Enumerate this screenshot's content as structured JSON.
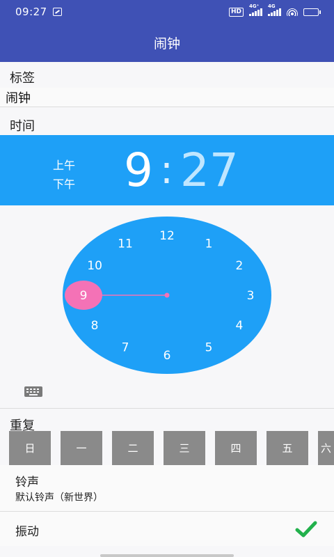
{
  "status_bar": {
    "time": "09:27",
    "hd": "HD",
    "sim1": "4G⁺",
    "sim2": "4G"
  },
  "app_bar": {
    "title": "闹钟"
  },
  "label_section": {
    "heading": "标签",
    "value": "闹钟"
  },
  "time_section": {
    "heading": "时间",
    "am": "上午",
    "pm": "下午",
    "hour": "9",
    "separator": ":",
    "minute": "27"
  },
  "clock": {
    "numbers": [
      "12",
      "1",
      "2",
      "3",
      "4",
      "5",
      "6",
      "7",
      "8",
      "9",
      "10",
      "11"
    ],
    "selected_hour": 9,
    "face_color": "#1ea0f7",
    "hand_color": "#f472b6"
  },
  "repeat_section": {
    "heading": "重复",
    "days": [
      "日",
      "一",
      "二",
      "三",
      "四",
      "五",
      "六"
    ]
  },
  "ringtone_section": {
    "title": "铃声",
    "value": "默认铃声（新世界）"
  },
  "vibrate_section": {
    "title": "振动",
    "checked": true
  },
  "colors": {
    "primary": "#3f51b5",
    "accent": "#1ea0f7",
    "day_button": "#8a8a8a",
    "check": "#22b14c"
  }
}
